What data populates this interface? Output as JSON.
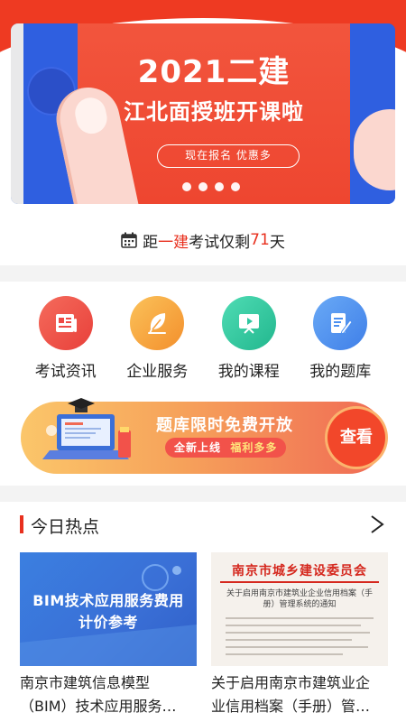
{
  "banner": {
    "title": "2021二建",
    "subtitle": "江北面授班开课啦",
    "cta": "现在报名 优惠多",
    "slide_count": 4
  },
  "countdown": {
    "prefix": "距",
    "exam_highlight": "一建",
    "middle": "考试仅剩",
    "days": "71",
    "suffix": "天"
  },
  "entries": [
    {
      "label": "考试资讯",
      "icon": "newspaper-icon",
      "color": "#ee4a45"
    },
    {
      "label": "企业服务",
      "icon": "feather-icon",
      "color": "#f6a13c"
    },
    {
      "label": "我的课程",
      "icon": "video-lesson-icon",
      "color": "#2fc7a0"
    },
    {
      "label": "我的题库",
      "icon": "edit-document-icon",
      "color": "#4a8ff0"
    }
  ],
  "promo": {
    "title": "题库限时免费开放",
    "sub_white": "全新上线",
    "sub_yellow": "福利多多",
    "button": "查看"
  },
  "hot": {
    "title": "今日热点",
    "articles": [
      {
        "thumb_title_line1": "BIM技术应用服务费用",
        "thumb_title_line2": "计价参考",
        "caption_line1": "南京市建筑信息模型",
        "caption_line2": "（BIM）技术应用服务…"
      },
      {
        "thumb_header": "南京市城乡建设委员会",
        "thumb_doc_title": "关于启用南京市建筑业企业信用档案（手册）管理系统的通知",
        "caption_line1": "关于启用南京市建筑业企",
        "caption_line2": "业信用档案（手册）管…"
      }
    ]
  },
  "colors": {
    "brand_red": "#e8301e",
    "banner_blue": "#2f5fe0",
    "banner_orange": "#f2553d"
  }
}
